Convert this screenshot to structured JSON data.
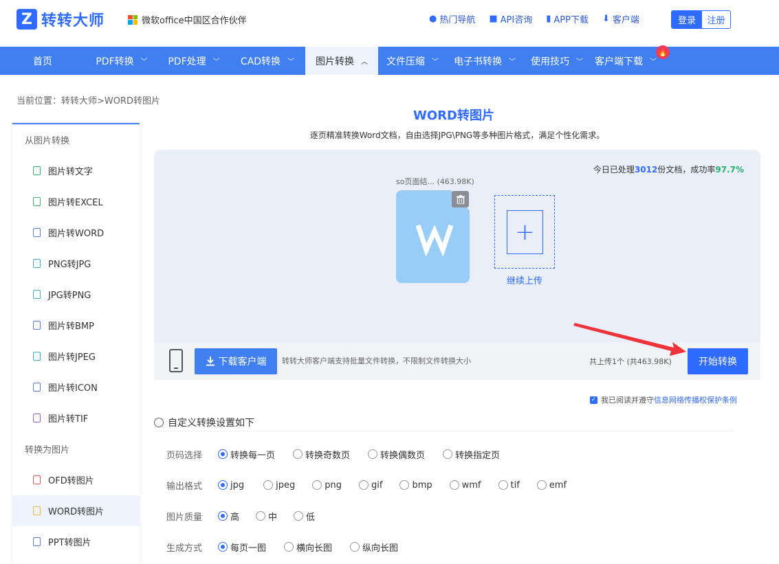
{
  "header": {
    "logo_text": "转转大师",
    "logo_mark": "Z",
    "partner_text": "微软office中国区合作伙伴",
    "links": [
      {
        "icon": "fire-icon",
        "label": "热门导航"
      },
      {
        "icon": "chat-icon",
        "label": "API咨询"
      },
      {
        "icon": "phone-icon",
        "label": "APP下载"
      },
      {
        "icon": "download-icon",
        "label": "客户端"
      }
    ],
    "login_label": "登录",
    "register_label": "注册"
  },
  "nav": {
    "items": [
      {
        "label": "首页",
        "chevron": "",
        "width": 0
      },
      {
        "label": "PDF转换",
        "chevron": "﹀"
      },
      {
        "label": "PDF处理",
        "chevron": "﹀"
      },
      {
        "label": "CAD转换",
        "chevron": "﹀"
      },
      {
        "label": "图片转换",
        "chevron": "︿"
      },
      {
        "label": "文件压缩",
        "chevron": "﹀"
      },
      {
        "label": "电子书转换",
        "chevron": "﹀"
      },
      {
        "label": "使用技巧",
        "chevron": "﹀"
      },
      {
        "label": "客户端下载",
        "chevron": "﹀"
      }
    ],
    "hot_badge": "🔥"
  },
  "breadcrumb": "当前位置：转转大师>WORD转图片",
  "sidebar": {
    "group1": "从图片转换",
    "items1": [
      {
        "label": "图片转文字"
      },
      {
        "label": "图片转EXCEL"
      },
      {
        "label": "图片转WORD"
      },
      {
        "label": "PNG转JPG"
      },
      {
        "label": "JPG转PNG"
      },
      {
        "label": "图片转BMP"
      },
      {
        "label": "图片转JPEG"
      },
      {
        "label": "图片转ICON"
      },
      {
        "label": "图片转TIF"
      }
    ],
    "group2": "转换为图片",
    "items2": [
      {
        "label": "OFD转图片"
      },
      {
        "label": "WORD转图片"
      },
      {
        "label": "PPT转图片"
      }
    ]
  },
  "main": {
    "title": "WORD转图片",
    "subtitle": "逐页精准转换Word文档，自由选择JPG\\PNG等多种图片格式，满足个性化需求。"
  },
  "upload": {
    "stats_prefix": "今日已处理",
    "stats_count": "3012",
    "stats_mid": "份文档，成功率",
    "stats_rate": "97.7%",
    "file_name": "so页面结...  (463.98K)",
    "file_letter": "W",
    "add_label": "继续上传",
    "add_symbol": "+"
  },
  "action": {
    "download_label": "下载客户端",
    "download_note": "转转大师客户端支持批量文件转换，不限制文件转换大小",
    "upload_count": "共上传1个  (共463.98K)",
    "start_label": "开始转换"
  },
  "agree": {
    "text": "我已阅读并遵守",
    "link": "信息网络传播权保护条例"
  },
  "settings": {
    "title": "自定义转换设置如下",
    "rows": [
      {
        "label": "页码选择",
        "options": [
          "转换每一页",
          "转换奇数页",
          "转换偶数页",
          "转换指定页"
        ],
        "selected": 0
      },
      {
        "label": "输出格式",
        "options": [
          "jpg",
          "jpeg",
          "png",
          "gif",
          "bmp",
          "wmf",
          "tif",
          "emf"
        ],
        "selected": 0
      },
      {
        "label": "图片质量",
        "options": [
          "高",
          "中",
          "低"
        ],
        "selected": 0
      },
      {
        "label": "生成方式",
        "options": [
          "每页一图",
          "横向长图",
          "纵向长图"
        ],
        "selected": 0
      }
    ]
  },
  "colors": {
    "brand": "#2f6bff",
    "nav": "#3f7ff2",
    "success": "#21b36b",
    "arrow": "#f0323a"
  }
}
